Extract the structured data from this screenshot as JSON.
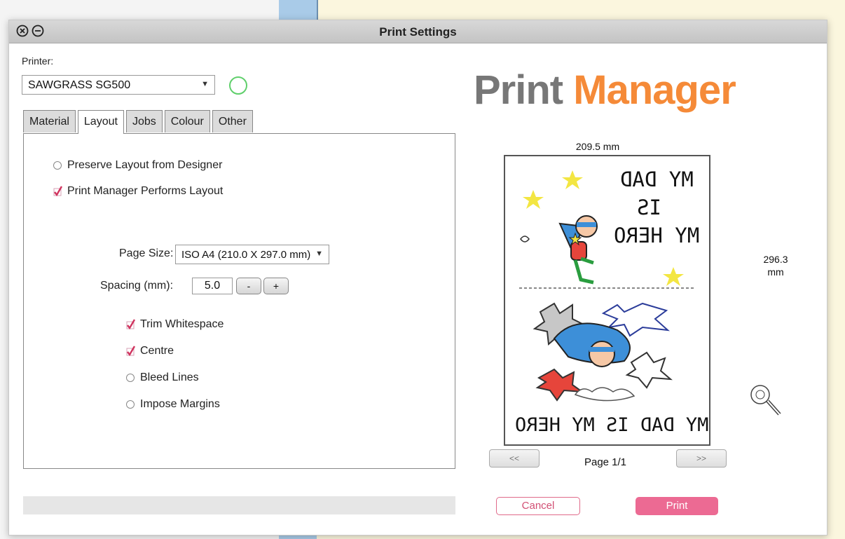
{
  "window": {
    "title": "Print Settings"
  },
  "printer": {
    "label": "Printer:",
    "selected": "SAWGRASS SG500"
  },
  "tabs": [
    {
      "label": "Material"
    },
    {
      "label": "Layout"
    },
    {
      "label": "Jobs"
    },
    {
      "label": "Colour"
    },
    {
      "label": "Other"
    }
  ],
  "active_tab": "Layout",
  "layout": {
    "preserve_label": "Preserve Layout from Designer",
    "performs_label": "Print Manager Performs Layout",
    "page_size_label": "Page Size:",
    "page_size_value": "ISO A4 (210.0 X 297.0 mm)",
    "spacing_label": "Spacing (mm):",
    "spacing_value": "5.0",
    "minus": "-",
    "plus": "+",
    "trim_label": "Trim Whitespace",
    "centre_label": "Centre",
    "bleed_label": "Bleed Lines",
    "impose_label": "Impose Margins"
  },
  "logo": {
    "part1": "Print",
    "part2": "Manager"
  },
  "preview": {
    "width_label": "209.5 mm",
    "height_value": "296.3",
    "height_unit": "mm",
    "top_text_line1": "MY DAD",
    "top_text_line2": "IS",
    "top_text_line3": "MY HERO",
    "bottom_text": "MY DAD IS MY HERO",
    "page_indicator": "Page 1/1",
    "prev": "<<",
    "next": ">>"
  },
  "actions": {
    "cancel": "Cancel",
    "print": "Print"
  },
  "colors": {
    "accent": "#ec6a93",
    "logo_grey": "#777777",
    "logo_orange": "#f58a38",
    "status_circle": "#5fcf6b"
  },
  "icons": [
    "close-icon",
    "minimize-icon",
    "chevron-down-icon",
    "checkmark-icon",
    "magnifier-icon"
  ]
}
